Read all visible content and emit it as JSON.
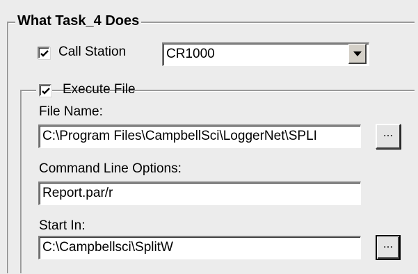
{
  "group_title": "What Task_4 Does",
  "call_station": {
    "checked": true,
    "label": "Call Station",
    "selected_value": "CR1000"
  },
  "execute_file": {
    "checked": true,
    "label": "Execute File",
    "file_name_label": "File Name:",
    "file_name_value": "C:\\Program Files\\CampbellSci\\LoggerNet\\SPLI",
    "browse_label": "...",
    "command_line_label": "Command Line Options:",
    "command_line_value": "Report.par/r",
    "start_in_label": "Start In:",
    "start_in_value": "C:\\Campbellsci\\SplitW",
    "start_in_browse_label": "..."
  },
  "icons": {
    "checkmark": "checkmark-icon",
    "dropdown": "chevron-down-icon"
  }
}
